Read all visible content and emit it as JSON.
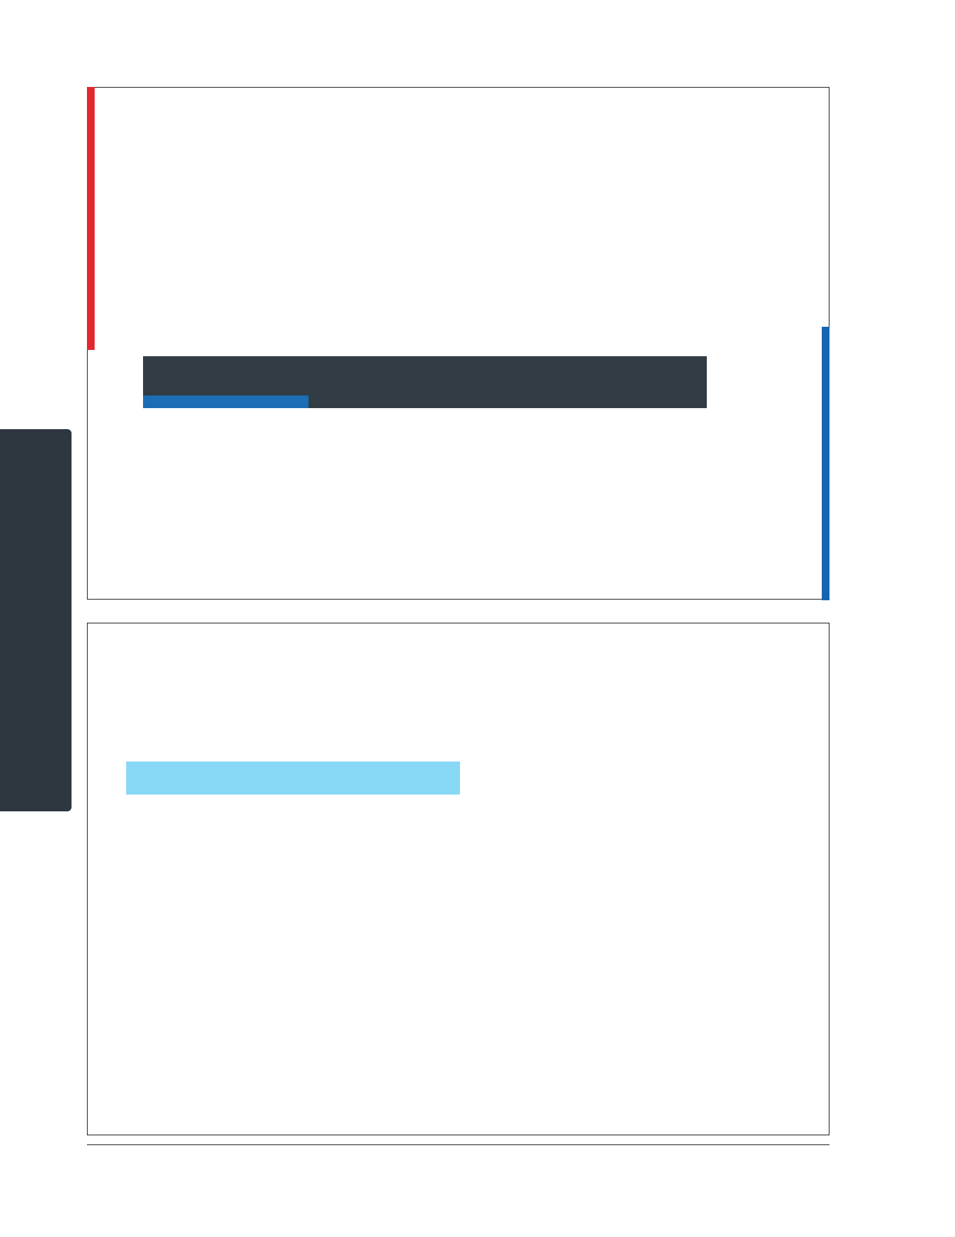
{
  "document": {
    "colors": {
      "side_tab": "#2e3740",
      "accent_red": "#e2282e",
      "accent_blue": "#1565b0",
      "title_bar": "#323c44",
      "title_underline": "#1b6db5",
      "highlight": "#86d8f5",
      "frame_border": "#222222"
    },
    "top_slide": {
      "title": ""
    },
    "bottom_slide": {
      "highlight_text": ""
    }
  }
}
